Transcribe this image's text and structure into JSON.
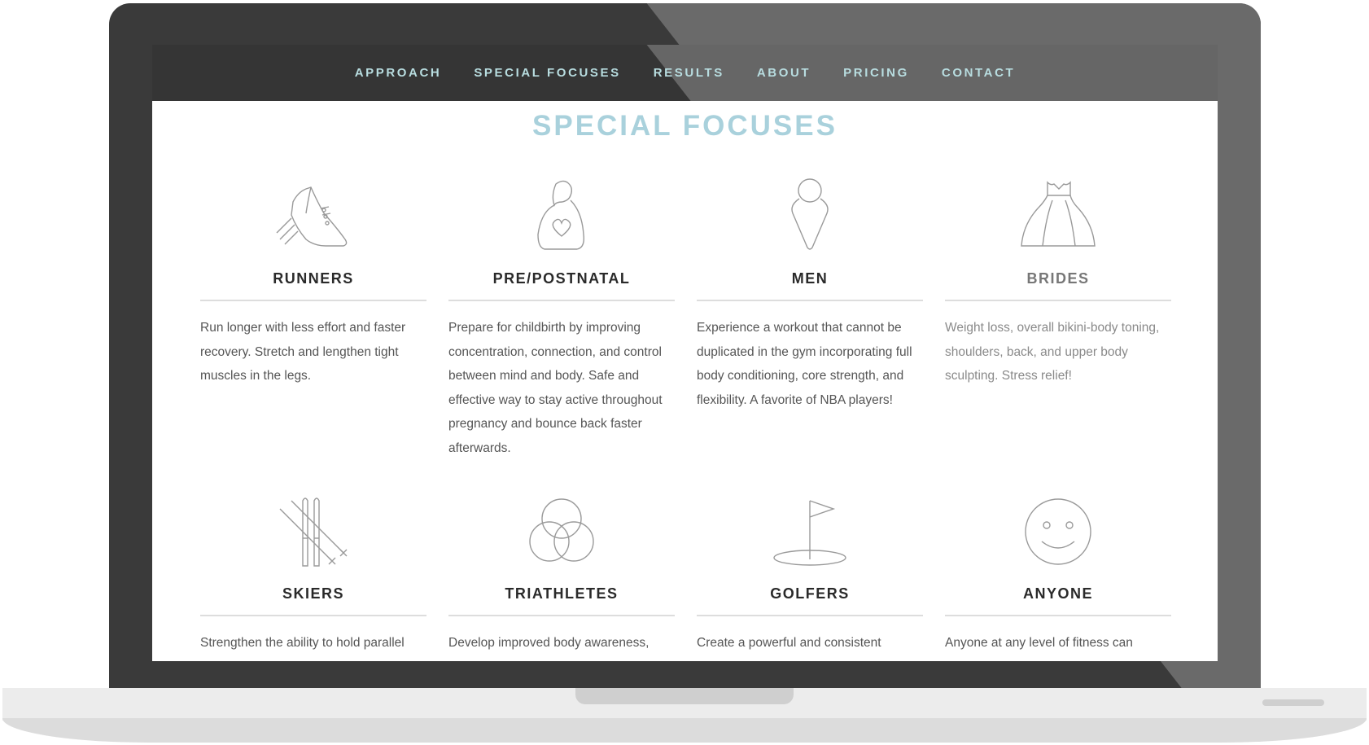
{
  "nav": {
    "items": [
      "APPROACH",
      "SPECIAL FOCUSES",
      "RESULTS",
      "ABOUT",
      "PRICING",
      "CONTACT"
    ]
  },
  "section": {
    "title": "SPECIAL FOCUSES"
  },
  "cards": [
    {
      "icon": "shoe-icon",
      "title": "RUNNERS",
      "desc": "Run longer with less effort and faster recovery. Stretch and lengthen tight muscles in the legs."
    },
    {
      "icon": "pregnant-heart-icon",
      "title": "PRE/POSTNATAL",
      "desc": "Prepare for childbirth by improving concentration, connection, and control between mind and body. Safe and effective way to stay active throughout pregnancy and bounce back faster afterwards."
    },
    {
      "icon": "man-icon",
      "title": "MEN",
      "desc": "Experience a workout that cannot be duplicated in the gym incorporating full body conditioning, core strength, and flexibility. A favorite of NBA players!"
    },
    {
      "icon": "wedding-dress-icon",
      "title": "BRIDES",
      "desc": "Weight loss, overall bikini-body toning, shoulders, back, and upper body sculpting. Stress relief!"
    },
    {
      "icon": "skis-icon",
      "title": "SKIERS",
      "desc": "Strengthen the ability to hold parallel"
    },
    {
      "icon": "three-circles-icon",
      "title": "TRIATHLETES",
      "desc": "Develop improved body awareness,"
    },
    {
      "icon": "golf-flag-icon",
      "title": "GOLFERS",
      "desc": "Create a powerful and consistent"
    },
    {
      "icon": "smiley-icon",
      "title": "ANYONE",
      "desc": "Anyone at any level of fitness can"
    }
  ]
}
